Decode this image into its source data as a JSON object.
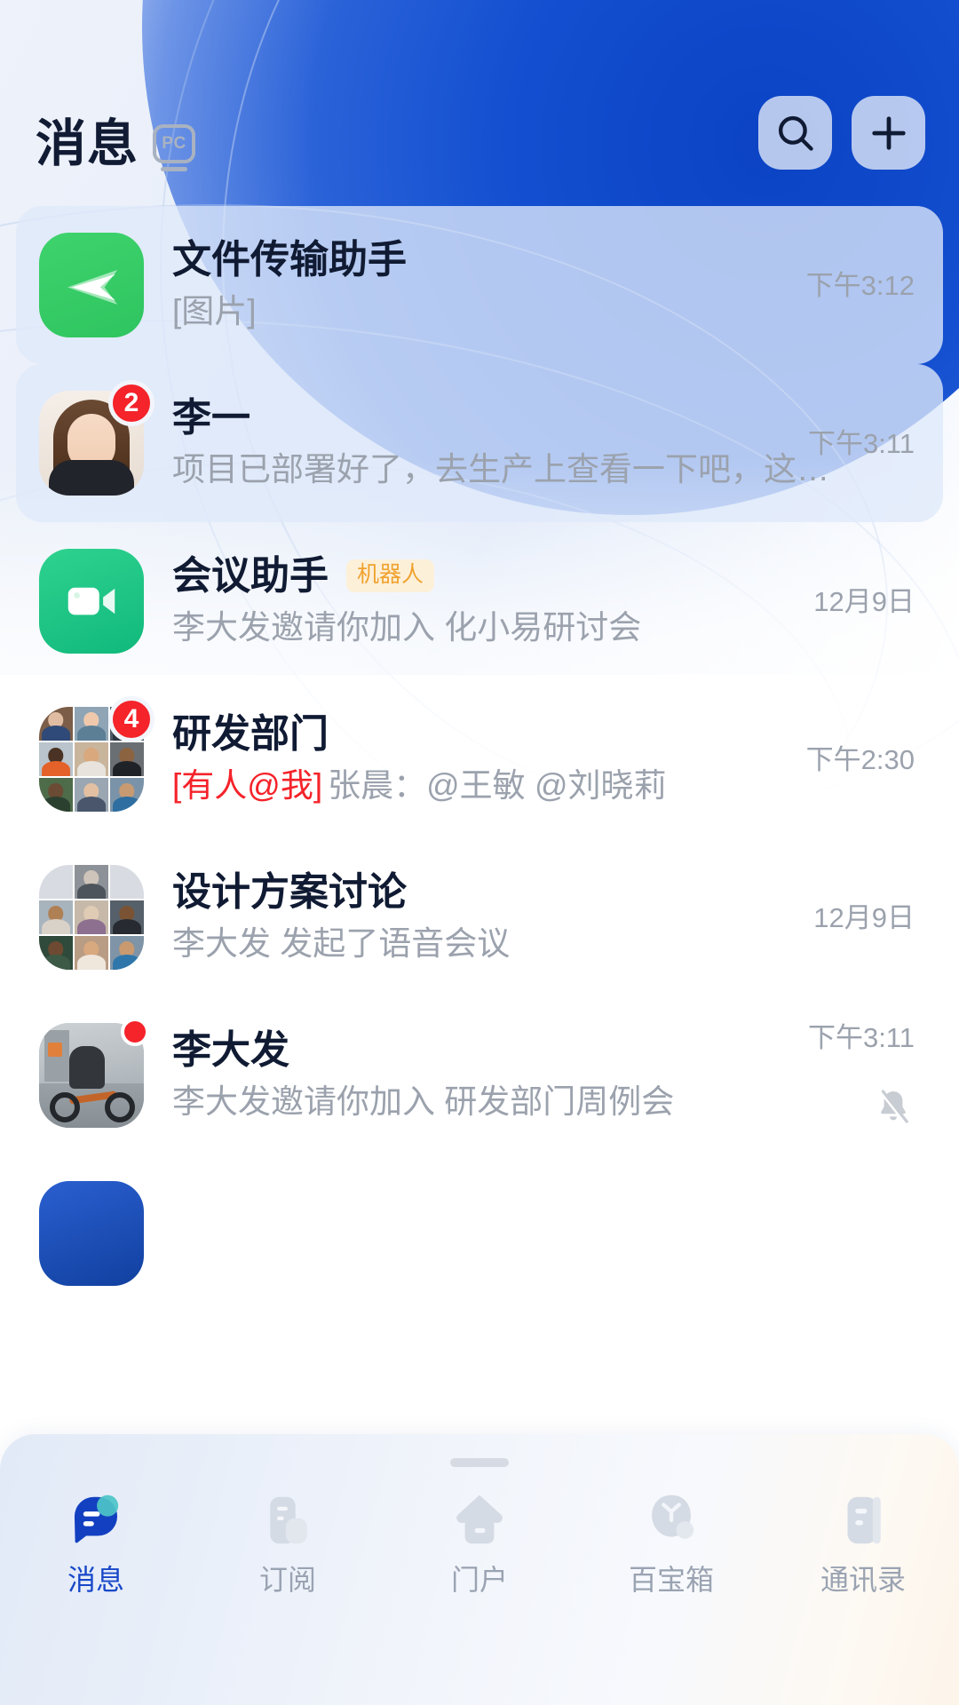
{
  "header": {
    "title": "消息",
    "pc_badge": "PC",
    "search_icon": "search-icon",
    "add_icon": "plus-icon"
  },
  "chats": [
    {
      "name": "文件传输助手",
      "preview": "[图片]",
      "time": "下午3:12",
      "badge": "",
      "tag": "",
      "muted": false,
      "unread_card": true,
      "avatar": "file-transfer"
    },
    {
      "name": "李一",
      "preview": "项目已部署好了，去生产上查看一下吧，这…",
      "time": "下午3:11",
      "badge": "2",
      "tag": "",
      "muted": false,
      "unread_card": true,
      "avatar": "portrait-woman"
    },
    {
      "name": "会议助手",
      "preview": "李大发邀请你加入 化小易研讨会",
      "time": "12月9日",
      "badge": "",
      "tag": "机器人",
      "muted": false,
      "unread_card": false,
      "avatar": "meeting-camera"
    },
    {
      "name": "研发部门",
      "preview_flag": "[有人@我]",
      "preview": "张晨：@王敏 @刘晓莉",
      "time": "下午2:30",
      "badge": "4",
      "tag": "",
      "muted": false,
      "unread_card": false,
      "avatar": "group-9"
    },
    {
      "name": "设计方案讨论",
      "preview": "李大发 发起了语音会议",
      "time": "12月9日",
      "badge": "",
      "tag": "",
      "muted": false,
      "unread_card": false,
      "avatar": "group-7"
    },
    {
      "name": "李大发",
      "preview": "李大发邀请你加入 研发部门周例会",
      "time": "下午3:11",
      "badge": "dot",
      "tag": "",
      "muted": true,
      "unread_card": false,
      "avatar": "motorcycle"
    }
  ],
  "tabs": [
    {
      "label": "消息",
      "icon": "chat-bubble-icon",
      "active": true
    },
    {
      "label": "订阅",
      "icon": "subscribe-icon",
      "active": false
    },
    {
      "label": "门户",
      "icon": "portal-home-icon",
      "active": false
    },
    {
      "label": "百宝箱",
      "icon": "toolbox-icon",
      "active": false
    },
    {
      "label": "通讯录",
      "icon": "contacts-icon",
      "active": false
    }
  ],
  "colors": {
    "accent": "#1747c8",
    "badge_red": "#f5232a",
    "bot_tag": "#f0a22e",
    "title": "#101b33",
    "muted_text": "#9ba2ad"
  }
}
